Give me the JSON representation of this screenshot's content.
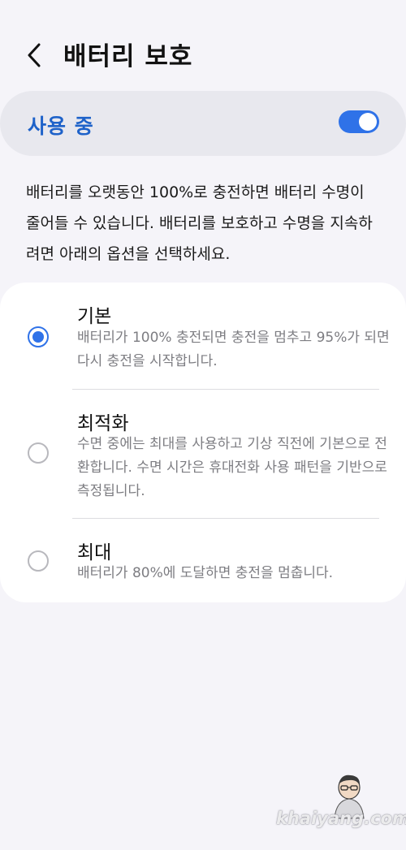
{
  "header": {
    "title": "배터리 보호",
    "back_icon": "chevron-left-icon"
  },
  "master_switch": {
    "label": "사용 중",
    "enabled": true,
    "accent_color": "#2f72e8",
    "label_color": "#1e62c9"
  },
  "description": "배터리를 오랫동안 100%로 충전하면 배터리 수명이 줄어들 수 있습니다. 배터리를 보호하고 수명을 지속하려면 아래의 옵션을 선택하세요.",
  "options": [
    {
      "title": "기본",
      "description": "배터리가 100% 충전되면 충전을 멈추고 95%가 되면 다시 충전을 시작합니다.",
      "selected": true
    },
    {
      "title": "최적화",
      "description": "수면 중에는 최대를 사용하고 기상 직전에 기본으로 전환합니다. 수면 시간은 휴대전화 사용 패턴을 기반으로 측정됩니다.",
      "selected": false
    },
    {
      "title": "최대",
      "description": "배터리가 80%에 도달하면 충전을 멈춥니다.",
      "selected": false
    }
  ],
  "watermark": {
    "text": "khaiyang.com"
  }
}
